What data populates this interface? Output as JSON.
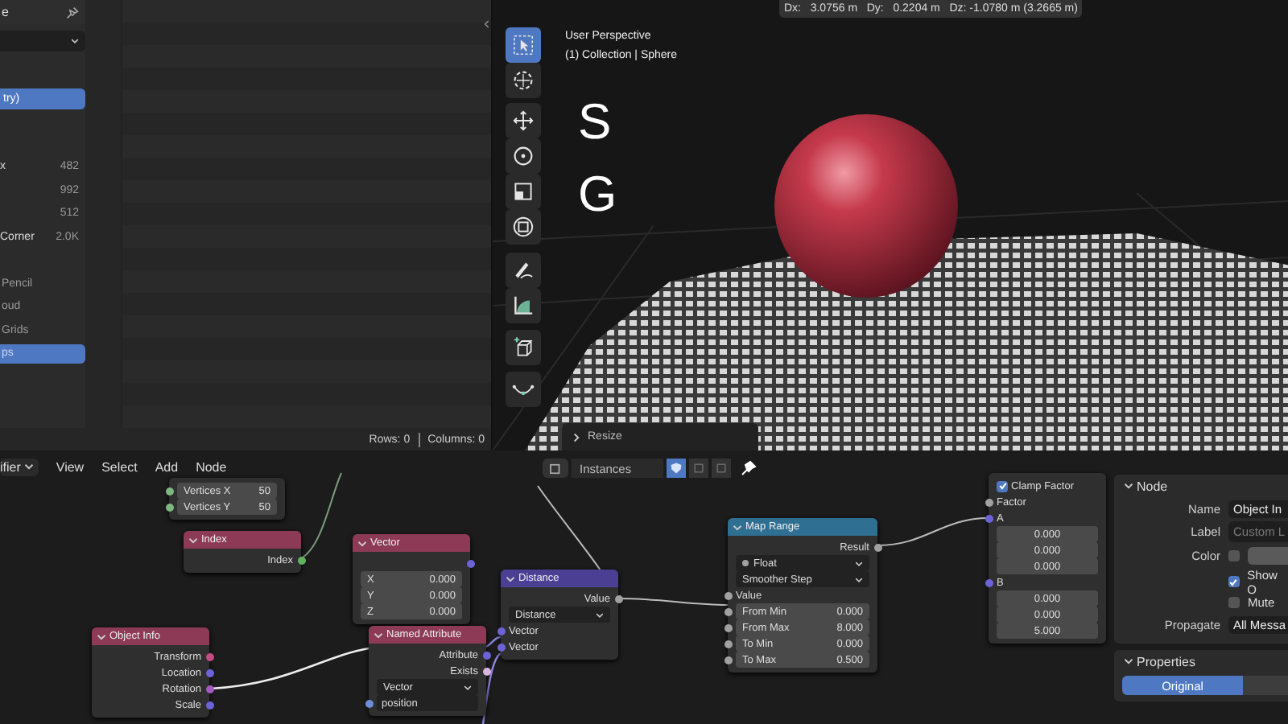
{
  "spreadsheet": {
    "title": "e",
    "objects": [
      {
        "label": "try)",
        "selected": true
      }
    ],
    "counts": [
      {
        "label": "x",
        "count": "482"
      },
      {
        "count": "992"
      },
      {
        "count": "512"
      },
      {
        "label": "Corner",
        "count": "2.0K"
      }
    ],
    "domains": [
      {
        "label": "Pencil",
        "selected": false
      },
      {
        "label": "oud",
        "selected": false
      },
      {
        "label": "Grids",
        "selected": false
      },
      {
        "label": "ps",
        "selected": true
      }
    ],
    "status": {
      "rows": "Rows: 0",
      "columns": "Columns: 0"
    }
  },
  "viewport": {
    "measure": "Dx:   3.0756 m   Dy:   0.2204 m   Dz: -1.0780 m (3.2665 m)",
    "title": "User Perspective",
    "subtitle": "(1) Collection | Sphere",
    "keys": [
      "S",
      "G"
    ],
    "tools": [
      {
        "kind": "select",
        "selected": true
      },
      {
        "kind": "cursor",
        "selected": false
      },
      {
        "kind": "move",
        "selected": false
      },
      {
        "kind": "rotate",
        "selected": false
      },
      {
        "kind": "scale",
        "selected": false
      },
      {
        "kind": "transform",
        "selected": false
      },
      {
        "kind": "annotate",
        "selected": false
      },
      {
        "kind": "measure",
        "selected": false
      },
      {
        "kind": "add_cube",
        "selected": false
      },
      {
        "kind": "curve",
        "selected": false
      }
    ],
    "last_operator": "Resize"
  },
  "node_editor": {
    "editor_type": "ifier",
    "menus": [
      "View",
      "Select",
      "Add",
      "Node"
    ],
    "context": "Instances",
    "pinned": true,
    "toggles": [
      {
        "selected": true
      },
      {
        "selected": false
      },
      {
        "selected": false
      }
    ],
    "nodes": [
      {
        "rows": [
          {
            "kind": "field",
            "label": "Vertices X",
            "value": "50",
            "color": "#7fb87f"
          },
          {
            "kind": "field",
            "label": "Vertices Y",
            "value": "50",
            "color": "#7fb87f"
          }
        ]
      },
      {
        "title": "Index",
        "color": "#8c3a55",
        "rows": [
          {
            "kind": "output",
            "label": "Index",
            "color": "#5fb35f"
          }
        ]
      },
      {
        "title": "Vector",
        "color": "#8c3a55",
        "rows": [
          {
            "kind": "output",
            "color": "#6c63d8"
          },
          {
            "kind": "field",
            "label": "X",
            "value": "0.000"
          },
          {
            "kind": "field",
            "label": "Y",
            "value": "0.000"
          },
          {
            "kind": "field",
            "label": "Z",
            "value": "0.000"
          }
        ]
      },
      {
        "title": "Object Info",
        "color": "#8c3a55",
        "rows": [
          {
            "kind": "output",
            "label": "Transform",
            "color": "#c24c85"
          },
          {
            "kind": "output",
            "label": "Location",
            "color": "#6c63d8"
          },
          {
            "kind": "output",
            "label": "Rotation",
            "color": "#a35bc2"
          },
          {
            "kind": "output",
            "label": "Scale",
            "color": "#6c63d8"
          }
        ]
      },
      {
        "title": "Named Attribute",
        "color": "#8c3a55",
        "rows": [
          {
            "kind": "output",
            "label": "Attribute",
            "color": "#6c63d8"
          },
          {
            "kind": "output",
            "label": "Exists",
            "color": "#d8b4e0"
          },
          {
            "kind": "dropdown",
            "value": "Vector"
          },
          {
            "kind": "text",
            "value": "position",
            "color": "#6c8fd8"
          }
        ]
      },
      {
        "title": "Distance",
        "color": "#4b3f94",
        "rows": [
          {
            "kind": "output",
            "label": "Value",
            "color": "#a1a1a1"
          },
          {
            "kind": "dropdown",
            "value": "Distance"
          },
          {
            "kind": "input",
            "label": "Vector",
            "color": "#6c63d8"
          },
          {
            "kind": "input",
            "label": "Vector",
            "color": "#6c63d8"
          }
        ]
      },
      {
        "title": "Map Range",
        "color": "#2f6f92",
        "rows": [
          {
            "kind": "output",
            "label": "Result",
            "color": "#a1a1a1"
          },
          {
            "kind": "dropdown",
            "value": "Float",
            "color": "#a1a1a1"
          },
          {
            "kind": "dropdown",
            "value": "Smoother Step"
          },
          {
            "kind": "input",
            "label": "Value",
            "color": "#a1a1a1"
          },
          {
            "kind": "field",
            "label": "From Min",
            "value": "0.000",
            "color": "#a1a1a1"
          },
          {
            "kind": "field",
            "label": "From Max",
            "value": "8.000",
            "color": "#a1a1a1"
          },
          {
            "kind": "field",
            "label": "To Min",
            "value": "0.000",
            "color": "#a1a1a1"
          },
          {
            "kind": "field",
            "label": "To Max",
            "value": "0.500",
            "color": "#a1a1a1"
          }
        ]
      },
      {
        "rows": [
          {
            "kind": "checkbox",
            "label": "Clamp Factor",
            "checked": true
          },
          {
            "kind": "input",
            "label": "Factor",
            "color": "#a1a1a1"
          },
          {
            "kind": "input",
            "label": "A",
            "color": "#6c63d8"
          },
          {
            "kind": "field",
            "value": "0.000"
          },
          {
            "kind": "field",
            "value": "0.000"
          },
          {
            "kind": "field",
            "value": "0.000"
          },
          {
            "kind": "input",
            "label": "B",
            "color": "#6c63d8"
          },
          {
            "kind": "field",
            "value": "0.000"
          },
          {
            "kind": "field",
            "value": "0.000"
          },
          {
            "kind": "field",
            "value": "5.000"
          }
        ]
      }
    ]
  },
  "properties_panel": {
    "sections": [
      {
        "title": "Node",
        "expanded": true,
        "fields": [
          {
            "kind": "text",
            "label": "Name",
            "value": "Object In"
          },
          {
            "kind": "text",
            "label": "Label",
            "placeholder": "Custom L"
          },
          {
            "kind": "color",
            "label": "Color",
            "checked": false
          },
          {
            "kind": "checkbox",
            "label": "Show O",
            "checked": true
          },
          {
            "kind": "checkbox",
            "label": "Mute",
            "checked": false
          },
          {
            "kind": "dropdown",
            "label": "Propagate",
            "value": "All Messa"
          }
        ]
      },
      {
        "title": "Properties",
        "expanded": true,
        "tabs": [
          {
            "label": "Original",
            "selected": true
          },
          {
            "selected": false
          }
        ]
      }
    ]
  }
}
